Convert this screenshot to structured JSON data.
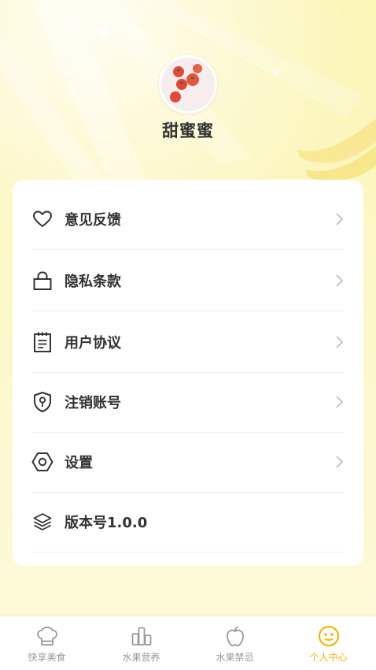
{
  "profile": {
    "nickname": "甜蜜蜜"
  },
  "menu": {
    "items": [
      {
        "label": "意见反馈",
        "icon": "heart-icon",
        "has_arrow": true
      },
      {
        "label": "隐私条款",
        "icon": "lock-icon",
        "has_arrow": true
      },
      {
        "label": "用户协议",
        "icon": "document-icon",
        "has_arrow": true
      },
      {
        "label": "注销账号",
        "icon": "shield-key-icon",
        "has_arrow": true
      },
      {
        "label": "设置",
        "icon": "settings-hex-icon",
        "has_arrow": true
      },
      {
        "label": "版本号1.0.0",
        "icon": "layers-icon",
        "has_arrow": false
      }
    ]
  },
  "tabbar": {
    "tabs": [
      {
        "label": "快享美食",
        "icon": "chef-hat-icon",
        "active": false
      },
      {
        "label": "水果营养",
        "icon": "bar-chart-icon",
        "active": false
      },
      {
        "label": "水果禁忌",
        "icon": "apple-icon",
        "active": false
      },
      {
        "label": "个人中心",
        "icon": "smiley-face-icon",
        "active": true
      }
    ]
  },
  "colors": {
    "accent": "#f5b400",
    "text_primary": "#333333",
    "text_secondary": "#999999",
    "background_yellow": "#fbf5b6"
  }
}
